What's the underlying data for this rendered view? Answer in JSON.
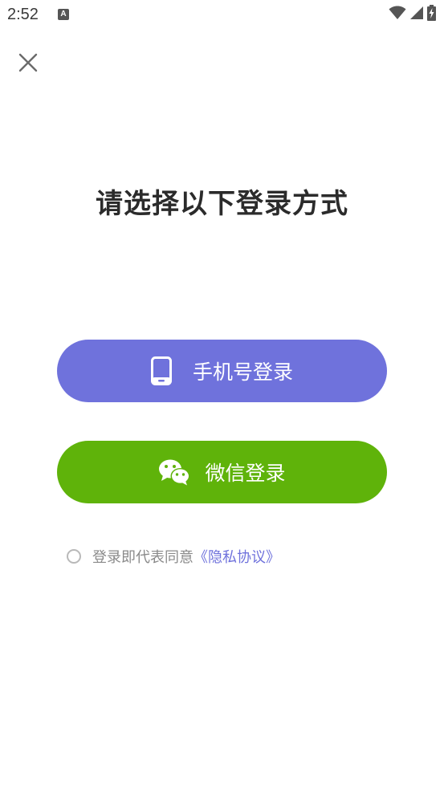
{
  "status_bar": {
    "time": "2:52",
    "notification_icon_label": "A",
    "icons": [
      "wifi-icon",
      "signal-icon",
      "battery-charging-icon"
    ]
  },
  "header": {
    "close_icon": "close-icon"
  },
  "main": {
    "title": "请选择以下登录方式",
    "phone_login": {
      "label": "手机号登录",
      "icon": "phone-icon",
      "color": "#6f72dc"
    },
    "wechat_login": {
      "label": "微信登录",
      "icon": "wechat-icon",
      "color": "#5fb30a"
    },
    "agreement": {
      "text": "登录即代表同意",
      "link": "《隐私协议》",
      "checked": false,
      "link_color": "#6f72dc"
    }
  }
}
